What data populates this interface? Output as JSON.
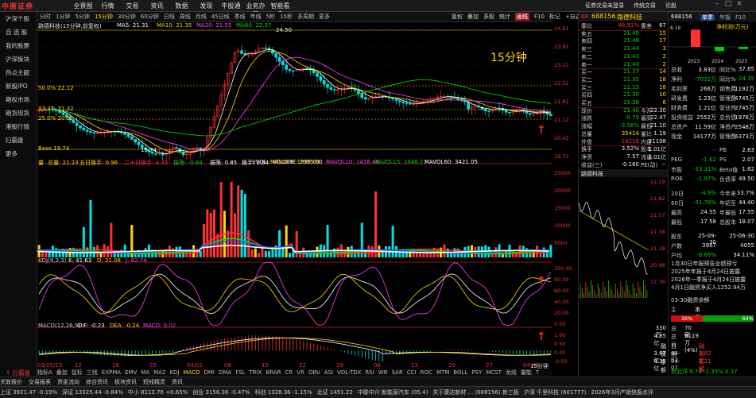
{
  "colors": {
    "up": "#ff3030",
    "down": "#00d000",
    "accent": "#ffd700",
    "bg": "#000000"
  },
  "app": {
    "logo": "中原证券",
    "menu": [
      "全景图",
      "行情",
      "交易",
      "资讯",
      "数据",
      "发现",
      "牛股通",
      "业务办理",
      "智能看盘"
    ],
    "right_menu": [
      "证券交易未登录",
      "传统交易",
      "论股"
    ],
    "window_controls": [
      "–",
      "□",
      "×"
    ]
  },
  "nav": [
    "沪深个股",
    "自 选 股",
    "我的股票",
    "沪深板块",
    "热点主题",
    "新股IPO",
    "期权市场",
    "期货现货",
    "港股行情",
    "扫霸盘",
    "更多",
    "↑ 扫霸盘"
  ],
  "periods": [
    "分时",
    "1分钟",
    "5分钟",
    "15分钟",
    "30分钟",
    "60分钟",
    "日线",
    "周线",
    "月线",
    "45日线",
    "季线",
    "年线",
    "5秒",
    "15秒",
    "多周期",
    "更多"
  ],
  "active_period": "15分钟",
  "tools": [
    "复权",
    "叠加",
    "多股",
    "统计",
    "画线",
    "F10",
    "标记",
    "+自选",
    "返回"
  ],
  "active_tool": "画线",
  "chart": {
    "main_title": "路德科技(15分钟,前复权)",
    "ma": [
      {
        "label": "MA5: 21.31",
        "color": "#ffffff"
      },
      {
        "label": "MA10: 21.35",
        "color": "#ffd700"
      },
      {
        "label": "MA20: 21.55",
        "color": "#ff40ff"
      },
      {
        "label": "MA60: 22.37",
        "color": "#00e000"
      }
    ],
    "watermark": "15分钟",
    "hi_label": "24.50",
    "lo_label": "19.74",
    "base_label": "Base 19.74",
    "fib": [
      "50.0% 22.12",
      "33.3% 21.32",
      "25.0% 20.92"
    ],
    "vol_title": "VVOL - VOLUME: 2985.00",
    "vol_items": [
      {
        "t": "量",
        "c": "#ffd700"
      },
      {
        "t": "总量: 21.23",
        "c": "#ffd700"
      },
      {
        "t": "五日换手: 0.96",
        "c": "#ffd700"
      },
      {
        "t": "二十日换手: 4.33",
        "c": "#ff3030"
      },
      {
        "t": "振荡: -0.84",
        "c": "#00d000"
      },
      {
        "t": "振荡: 0.85",
        "c": "#ffffff"
      },
      {
        "t": "换手: 0.94",
        "c": "#ffffff"
      },
      {
        "t": "MAVOL5: 1935.60",
        "c": "#ffd700"
      },
      {
        "t": "MAVOL10: 1418.40",
        "c": "#ff40ff"
      },
      {
        "t": "MAVOL15: 1848.27",
        "c": "#00d000"
      },
      {
        "t": "MAVOL60: 3421.05",
        "c": "#ffffff"
      }
    ],
    "kdj": [
      {
        "t": "KDJ(9,3,3)",
        "c": "#cccccc"
      },
      {
        "t": "K: 41.63",
        "c": "#ffffff"
      },
      {
        "t": "D: 31.08",
        "c": "#ffd700"
      },
      {
        "t": "J: 62.74",
        "c": "#ff40ff"
      }
    ],
    "macd": [
      {
        "t": "MACD(12,26,9)",
        "c": "#cccccc"
      },
      {
        "t": "DIF: -0.23",
        "c": "#ffffff"
      },
      {
        "t": "DEA: -0.24",
        "c": "#ffd700"
      },
      {
        "t": "MACD: 0.02",
        "c": "#ff40ff"
      }
    ],
    "xlabels": [
      "03/05/15",
      "12",
      "18",
      "25",
      "04/01",
      "08",
      "15",
      "22",
      "29",
      "06",
      "13",
      "20",
      "27",
      "04:45"
    ],
    "price_axis": [
      "24.61",
      "23.91",
      "23.22",
      "22.52",
      "21.82",
      "21.12",
      "20.42",
      "19.72"
    ],
    "vol_axis": [
      "25000",
      "20000",
      "15000",
      "10000",
      "5000"
    ],
    "kdj_axis": [
      "100.00",
      "80.00",
      "60.00",
      "40.00",
      "20.00",
      "0.00"
    ],
    "macd_axis": [
      "1.00",
      "0.50",
      "0.00",
      "-0.50"
    ],
    "tab_label": "15分钟"
  },
  "indicators": [
    "指标A",
    "叠加",
    "鼠标",
    "三线",
    "EXPMA",
    "EMV",
    "MA",
    "MA2",
    "KDJ",
    "MACD",
    "DMI",
    "DMA",
    "FSL",
    "TRIX",
    "BRAR",
    "CR",
    "VR",
    "OBV",
    "ASI",
    "VOL-TDX",
    "RSI",
    "WR",
    "SAR",
    "CCI",
    "ROC",
    "MTM",
    "BOLL",
    "PSY",
    "MCST",
    "龙线",
    "量能",
    "T"
  ],
  "active_indicator": "MACD",
  "quote": {
    "code": "688156",
    "name": "路德科技",
    "rows": [
      {
        "l": "委比",
        "v": "48.91%",
        "c": "red",
        "l2": "委差",
        "v2": "67"
      },
      {
        "l": "卖五",
        "v": "21.49",
        "c": "green",
        "v2": "15"
      },
      {
        "l": "卖四",
        "v": "21.46",
        "c": "green",
        "v2": "17"
      },
      {
        "l": "卖三",
        "v": "21.44",
        "c": "green",
        "v2": "3"
      },
      {
        "l": "卖二",
        "v": "21.41",
        "c": "green",
        "v2": "2"
      },
      {
        "l": "卖一",
        "v": "21.40",
        "c": "green",
        "v2": "2"
      },
      {
        "l": "买一",
        "v": "21.37",
        "c": "green",
        "v2": "14"
      },
      {
        "l": "买二",
        "v": "21.35",
        "c": "green",
        "v2": "18"
      },
      {
        "l": "买三",
        "v": "21.33",
        "c": "green",
        "v2": "18"
      },
      {
        "l": "买四",
        "v": "21.30",
        "c": "green",
        "v2": "10"
      },
      {
        "l": "买五",
        "v": "21.28",
        "c": "green",
        "v2": "6"
      },
      {
        "l": "现价",
        "v": "21.40",
        "c": "green",
        "l2": "今开",
        "v2": "22.30"
      },
      {
        "l": "涨跌",
        "v": "-0.79",
        "c": "green",
        "l2": "最高",
        "v2": "22.47"
      },
      {
        "l": "涨幅",
        "v": "-3.56%",
        "c": "green",
        "l2": "最低",
        "v2": "21.10"
      },
      {
        "l": "总量",
        "v": "35414",
        "c": "yellow",
        "l2": "量比",
        "v2": "1.19"
      },
      {
        "l": "外盘",
        "v": "14216",
        "c": "red",
        "l2": "内盘",
        "v2": "21198"
      },
      {
        "l": "换手",
        "v": "3.52%",
        "c": "white",
        "l2": "股本",
        "v2": "1.01亿"
      },
      {
        "l": "净资",
        "v": "7.57",
        "c": "white",
        "l2": "流通",
        "v2": "1.01亿"
      },
      {
        "l": "收益(三)",
        "v": "-0.160",
        "c": "white",
        "l2": "PE(动)",
        "v2": "--"
      }
    ],
    "tab2": "路德科技",
    "mini_axis": [
      "22.19",
      "21.82",
      "21.57",
      "21.38",
      "21.18",
      "20.98",
      "17.76"
    ],
    "tab3": "交易"
  },
  "fpanel": {
    "code": "688156",
    "tabs": [
      "单季",
      "年报",
      "F10"
    ],
    "chart_title": "净利润(万元)",
    "years": [
      "2023",
      "2024",
      "2025"
    ],
    "ytick": "6.19",
    "bar_values": [
      6.19,
      -1.5,
      -0.8
    ],
    "rows": [
      {
        "l": "总收",
        "v": "3.83亿",
        "l2": "同比%",
        "v2": "37.85"
      },
      {
        "l": "净利",
        "v": "-7032万",
        "l2": "同比%",
        "v2": "-24.35"
      },
      {
        "l": "毛利率",
        "v": "266万",
        "l2": "销售费",
        "v2": "1192万"
      },
      {
        "l": "研发费",
        "v": "1.23亿",
        "l2": "管理费",
        "v2": "4745万"
      },
      {
        "l": "财务费",
        "v": "1.21亿",
        "l2": "营业外",
        "v2": "2745万"
      },
      {
        "l": "投资收益",
        "v": "2552万",
        "l2": "总负债",
        "v2": "1978万"
      },
      {
        "l": "总资产",
        "v": "11.59亿",
        "l2": "净资产",
        "v2": "2548万"
      },
      {
        "l": "现金",
        "v": "14177万",
        "l2": "管理费",
        "v2": "4373万"
      },
      {
        "l": "",
        "v": "--",
        "l2": "PB",
        "v2": "2.63"
      },
      {
        "l": "PEG",
        "v": "-1.62",
        "l2": "PS",
        "v2": "2.07"
      },
      {
        "l": "市盈",
        "v": "-33.31%",
        "l2": "Beta值",
        "v2": "1.62"
      },
      {
        "l": "ROE",
        "v": "-1.97%",
        "l2": "负债率",
        "v2": "49.50"
      },
      {
        "l": "20日",
        "v": "-4.9%",
        "l2": "今年来",
        "v2": "33.7%"
      },
      {
        "l": "60日",
        "v": "-31.78%",
        "l2": "年初至",
        "v2": "44.40"
      },
      {
        "l": "最高",
        "v": "24.55",
        "l2": "年最低",
        "v2": "17.55"
      },
      {
        "l": "最低",
        "v": "17.58",
        "l2": "总股本",
        "v2": "18.07"
      },
      {
        "l": "股东",
        "v": "25-09-30",
        "l2": "",
        "v2": "25-06-30"
      },
      {
        "l": "户数",
        "v": "3867",
        "l2": "",
        "v2": "4055"
      },
      {
        "l": "户均",
        "v": "-6.68%",
        "l2": "",
        "v2": "34.11%"
      }
    ],
    "news": [
      "1月30日年报预告业绩预亏",
      "2025年年报于4月24日披露",
      "2026年一季报于4月24日披露",
      "4月1日融资净买入1252.94万"
    ],
    "tab_info": "03-30融资余额",
    "flow_tabs": [
      "主力",
      "本周"
    ],
    "flow_pct": [
      "36%",
      "64%"
    ],
    "stats": [
      {
        "l": "总",
        "v": "70家",
        "l2": "",
        "v2": "330万"
      },
      {
        "l": "总分",
        "v": "6119万(4%)",
        "l2": "",
        "v2": "4.85亿"
      }
    ],
    "extra": [
      {
        "l": "日期",
        "v": "融资买额",
        "v2": "融资余额"
      },
      {
        "l": "04-02",
        "v": "1.82亿",
        "v2": "3.67亿"
      },
      {
        "l": "04-01",
        "v": "2.21亿",
        "v2": "4.35亿"
      }
    ],
    "bottom": "新北洋 6.74 -2.35% 0.37"
  },
  "tabbar": [
    "关联报价",
    "交易报表",
    "资金流向",
    "综合资讯",
    "板块资讯",
    "短线精灵",
    "资讯"
  ],
  "status": [
    "上证 3921.47 -0.19%",
    "深证 13325.44 -0.84%",
    "中小 8112.76 +0.65%",
    "创业 3156.36 -0.47%",
    "科创 1328.36 -1.15%",
    "北证 1451.22",
    "中联中兴 新能源汽车 (05.4)",
    "关于康达新材 ... (688156) 新三板",
    "沪深 千里科技 (601777)",
    "2026年3月产销快报点评"
  ],
  "arrows": [
    "↑",
    "↑",
    "↑"
  ]
}
